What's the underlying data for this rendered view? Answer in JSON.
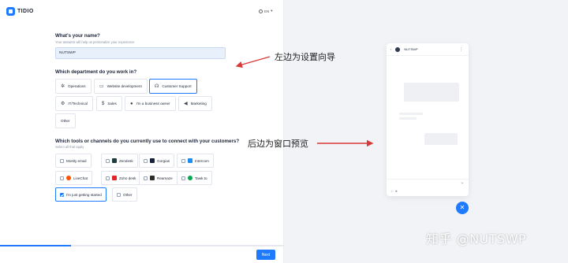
{
  "app": {
    "logo_text": "TIDIO",
    "language": "EN"
  },
  "name_section": {
    "question": "What's your name?",
    "hint": "Your answers will help us personalize your experience",
    "value": "NUTSWP"
  },
  "department_section": {
    "question": "Which department do you work in?",
    "options": [
      {
        "label": "Operations",
        "icon": "gear-icon",
        "selected": false
      },
      {
        "label": "Website development",
        "icon": "window-icon",
        "selected": false
      },
      {
        "label": "Customer Support",
        "icon": "headset-icon",
        "selected": true
      },
      {
        "label": "IT/Technical",
        "icon": "cog-icon",
        "selected": false
      },
      {
        "label": "Sales",
        "icon": "dollar-icon",
        "selected": false
      },
      {
        "label": "I'm a business owner",
        "icon": "person-icon",
        "selected": false
      },
      {
        "label": "Marketing",
        "icon": "megaphone-icon",
        "selected": false
      },
      {
        "label": "Other",
        "icon": "",
        "selected": false
      }
    ]
  },
  "tools_section": {
    "question": "Which tools or channels do you currently use to connect with your customers?",
    "hint": "Select all that apply",
    "options": [
      {
        "label": "Mostly email",
        "checked": false,
        "logo_color": ""
      },
      {
        "label": "Zendesk",
        "checked": false,
        "logo_color": "#1f3d3d"
      },
      {
        "label": "Gorgias",
        "checked": false,
        "logo_color": "#16213e"
      },
      {
        "label": "Intercom",
        "checked": false,
        "logo_color": "#1f8ded"
      },
      {
        "label": "LiveChat",
        "checked": false,
        "logo_color": "#ff5100"
      },
      {
        "label": "Zoho desk",
        "checked": false,
        "logo_color": "#e42527"
      },
      {
        "label": "Reamaze",
        "checked": false,
        "logo_color": "#2d2d2d"
      },
      {
        "label": "Tawk.to",
        "checked": false,
        "logo_color": "#03a84e"
      },
      {
        "label": "I'm just getting started",
        "checked": true,
        "logo_color": ""
      },
      {
        "label": "Other",
        "checked": false,
        "logo_color": ""
      }
    ]
  },
  "progress": {
    "fraction": 0.25
  },
  "next_label": "Next",
  "annotations": {
    "left": "左边为设置向导",
    "right": "后边为窗口预览"
  },
  "preview": {
    "name": "NUTSWP",
    "menu": "⋮",
    "send": "➢"
  },
  "fab_icon": "✕",
  "watermark": "知乎 @NUTSWP",
  "colors": {
    "accent": "#1e7bff",
    "annotation_arrow": "#d83a3a"
  }
}
